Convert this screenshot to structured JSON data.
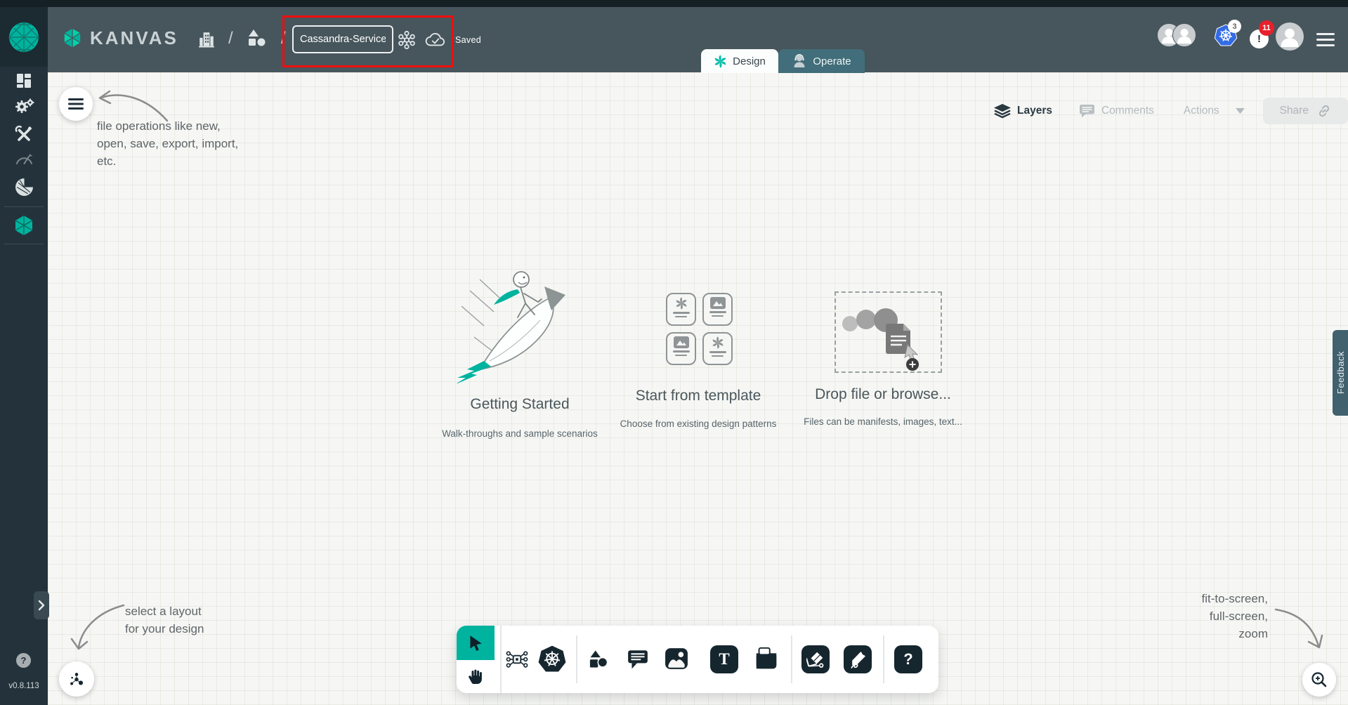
{
  "header": {
    "brand": "KANVAS",
    "separator": "/",
    "design_name": "Cassandra-Service",
    "saved_status": "Saved",
    "k8s_badge": "3",
    "alert_badge": "11"
  },
  "tabs": {
    "design": "Design",
    "operate": "Operate"
  },
  "sidebar": {
    "version": "v0.8.113",
    "help_glyph": "?"
  },
  "panel": {
    "layers": "Layers",
    "comments": "Comments",
    "actions": "Actions",
    "share": "Share"
  },
  "cards": {
    "getting_started": {
      "title": "Getting Started",
      "subtitle": "Walk-throughs and sample scenarios"
    },
    "template": {
      "title": "Start from template",
      "subtitle": "Choose from existing design patterns"
    },
    "drop": {
      "title": "Drop file or browse...",
      "subtitle": "Files can be manifests, images, text..."
    }
  },
  "annotations": {
    "file_ops": {
      "l1": "file operations like new,",
      "l2": "open, save, export, import,",
      "l3": "etc."
    },
    "layout": {
      "l1": "select a layout",
      "l2": "for your design"
    },
    "zoom": {
      "l1": "fit-to-screen,",
      "l2": "full-screen,",
      "l3": "zoom"
    }
  },
  "feedback": {
    "label": "Feedback"
  },
  "toolbar": {
    "text_glyph": "T",
    "help_glyph": "?"
  },
  "colors": {
    "accent": "#00B39F",
    "header_bg": "#47565C",
    "sidebar_bg": "#24333B",
    "highlight_red": "#F30D0D",
    "badge_red": "#E8202C",
    "k8s_blue": "#326CE5",
    "canvas_bg": "#F6F7F5"
  }
}
